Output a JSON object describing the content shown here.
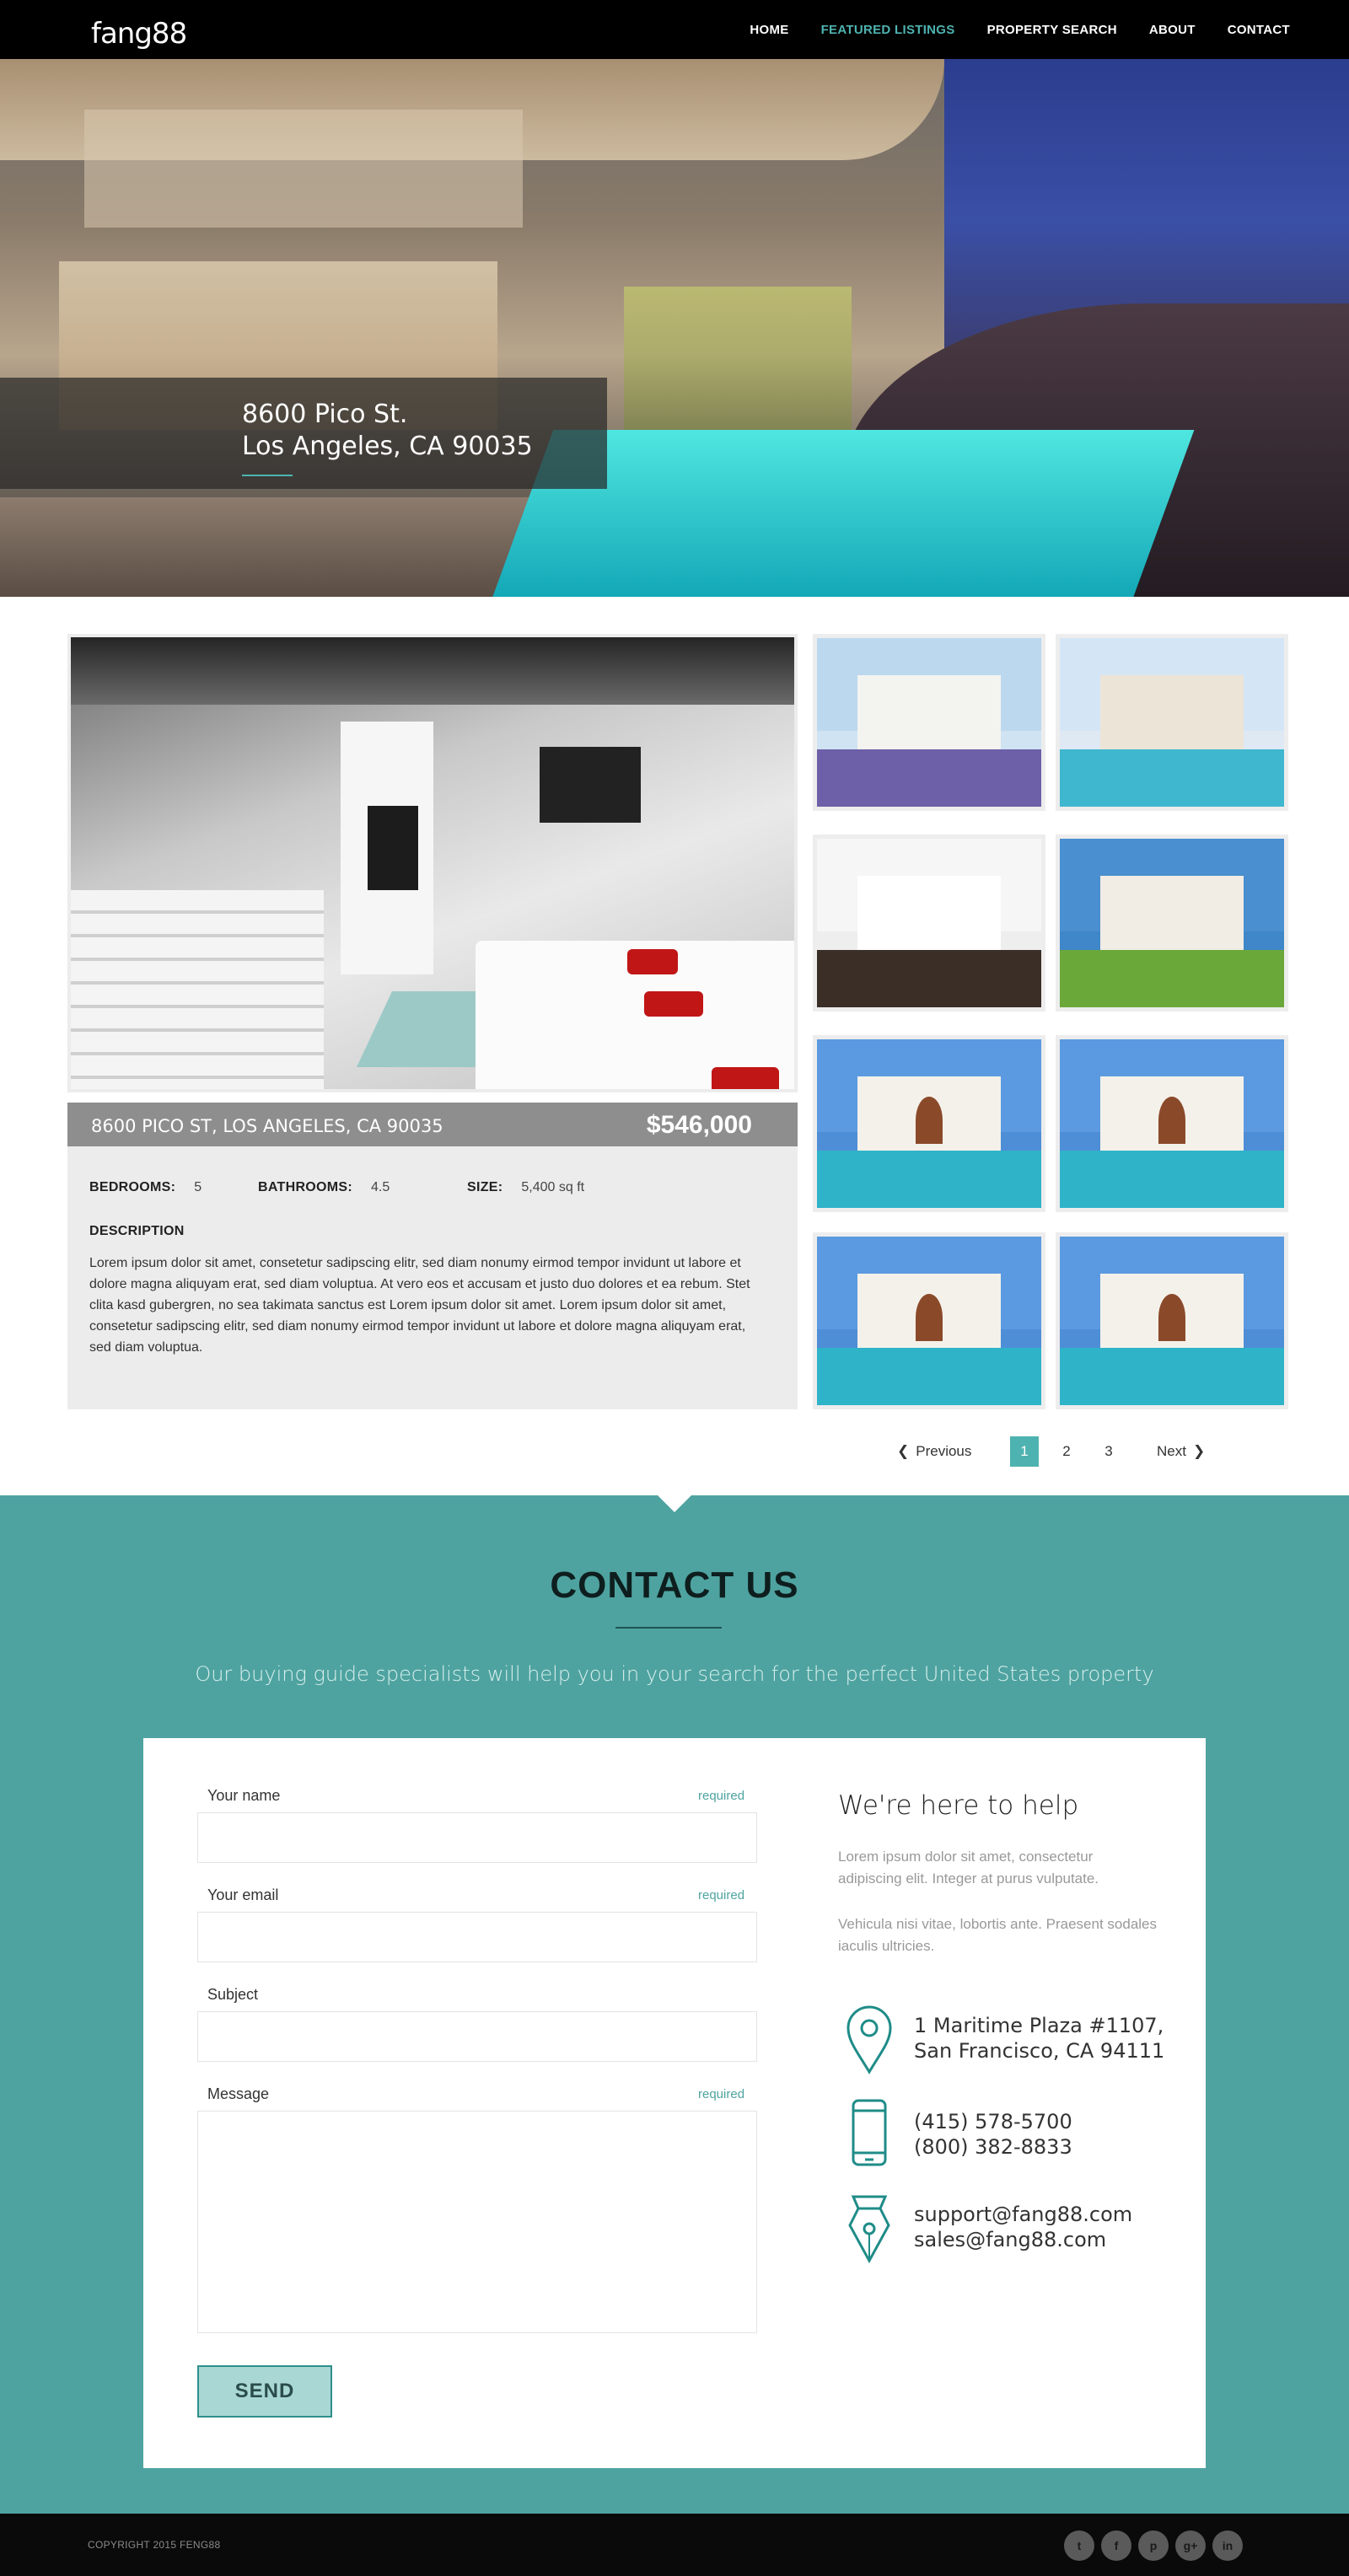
{
  "nav": {
    "logo_text": "fang88",
    "items": [
      {
        "label": "HOME",
        "active": false
      },
      {
        "label": "FEATURED LISTINGS",
        "active": true
      },
      {
        "label": "PROPERTY SEARCH",
        "active": false
      },
      {
        "label": "ABOUT",
        "active": false
      },
      {
        "label": "CONTACT",
        "active": false
      }
    ]
  },
  "hero": {
    "address_line1": "8600 Pico St.",
    "address_line2": "Los Angeles, CA 90035"
  },
  "listing": {
    "title": "8600 PICO ST, LOS ANGELES, CA 90035",
    "price": "$546,000",
    "bedrooms_label": "BEDROOMS:",
    "bedrooms": "5",
    "bathrooms_label": "BATHROOMS:",
    "bathrooms": "4.5",
    "size_label": "SIZE:",
    "size": "5,400 sq ft",
    "description_label": "DESCRIPTION",
    "description": "Lorem ipsum dolor sit amet, consetetur sadipscing elitr, sed diam nonumy eirmod tempor invidunt ut labore et dolore magna aliquyam erat, sed diam voluptua. At vero eos et accusam et justo duo dolores et ea rebum. Stet clita kasd gubergren, no sea takimata sanctus est Lorem ipsum dolor sit amet. Lorem ipsum dolor sit amet, consetetur sadipscing elitr,  sed diam nonumy eirmod tempor invidunt ut labore et dolore magna aliquyam erat, sed diam voluptua."
  },
  "pagination": {
    "previous_label": "Previous",
    "next_label": "Next",
    "pages": [
      "1",
      "2",
      "3"
    ],
    "current": "1"
  },
  "contact": {
    "title": "CONTACT US",
    "subtitle": "Our buying guide specialists will help you in your search for the perfect United States property",
    "form": {
      "name_label": "Your name",
      "email_label": "Your email",
      "subject_label": "Subject",
      "message_label": "Message",
      "required_text": "required",
      "send_label": "SEND"
    },
    "help": {
      "title": "We're here to help",
      "para1": "Lorem ipsum dolor sit amet, consectetur adipiscing elit. Integer at purus vulputate.",
      "para2": "Vehicula nisi vitae, lobortis ante. Praesent sodales iaculis ultricies.",
      "address_line1": "1 Maritime Plaza #1107,",
      "address_line2": "San Francisco, CA 94111",
      "phone1": "(415) 578-5700",
      "phone2": "(800) 382-8833",
      "email1": "support@fang88.com",
      "email2": "sales@fang88.com"
    }
  },
  "footer": {
    "copyright": "COPYRIGHT 2015 FENG88",
    "social": [
      {
        "icon": "twitter-icon",
        "glyph": "t"
      },
      {
        "icon": "facebook-icon",
        "glyph": "f"
      },
      {
        "icon": "pinterest-icon",
        "glyph": "p"
      },
      {
        "icon": "google-plus-icon",
        "glyph": "g+"
      },
      {
        "icon": "linkedin-icon",
        "glyph": "in"
      }
    ]
  },
  "colors": {
    "accent": "#4eb3b0",
    "contact_band": "#4ea3a0",
    "nav_bg": "#000000",
    "title_bar": "#8e8e8e"
  }
}
